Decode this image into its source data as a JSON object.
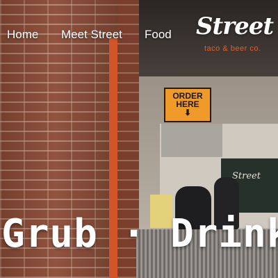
{
  "nav": {
    "items": [
      {
        "label": "Home"
      },
      {
        "label": "Meet Street"
      },
      {
        "label": "Food"
      }
    ]
  },
  "logo": {
    "name": "Street",
    "tagline": "taco & beer co."
  },
  "scene": {
    "sign_line1": "ORDER",
    "sign_line2": "HERE",
    "sign_arrow": "⬇",
    "board_text": "Street"
  },
  "headline": {
    "text": "Grub · Drink"
  },
  "colors": {
    "accent": "#e0602c",
    "sign": "#f09a2a"
  }
}
